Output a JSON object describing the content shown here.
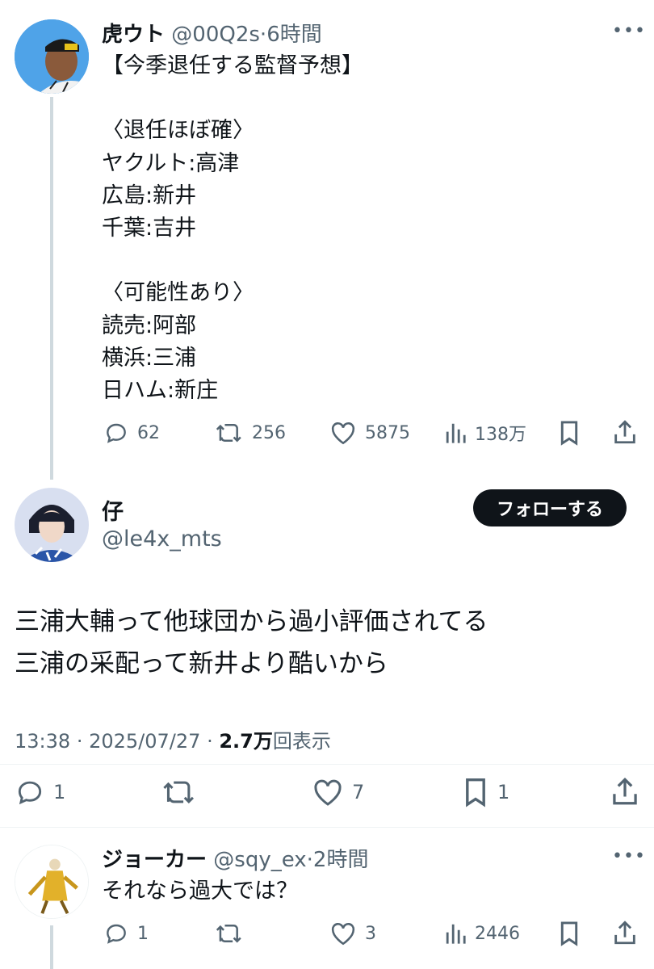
{
  "tweet1": {
    "name": "虎ウト",
    "handle": "@00Q2s",
    "time": "6時間",
    "more": "•••",
    "text": "【今季退任する監督予想】\n\n〈退任ほぼ確〉\nヤクルト:高津\n広島:新井\n千葉:吉井\n\n〈可能性あり〉\n読売:阿部\n横浜:三浦\n日ハム:新庄",
    "replies": "62",
    "retweets": "256",
    "likes": "5875",
    "views": "138万"
  },
  "main_tweet": {
    "name": "仔",
    "handle": "@le4x_mts",
    "follow_label": "フォローする",
    "text": "三浦大輔って他球団から過小評価されてる\n三浦の采配って新井より酷いから",
    "time": "13:38",
    "date": "2025/07/27",
    "views_count": "2.7万",
    "views_label": "回表示",
    "replies": "1",
    "likes": "7",
    "bookmarks": "1"
  },
  "tweet3": {
    "name": "ジョーカー",
    "handle": "@sqy_ex",
    "time": "2時間",
    "more": "•••",
    "text": "それなら過大では？",
    "replies": "1",
    "likes": "3",
    "views": "2446"
  },
  "colors": {
    "text": "#0f1419",
    "muted": "#536471",
    "thread_line": "#cfd9de",
    "button_bg": "#0f1419"
  }
}
